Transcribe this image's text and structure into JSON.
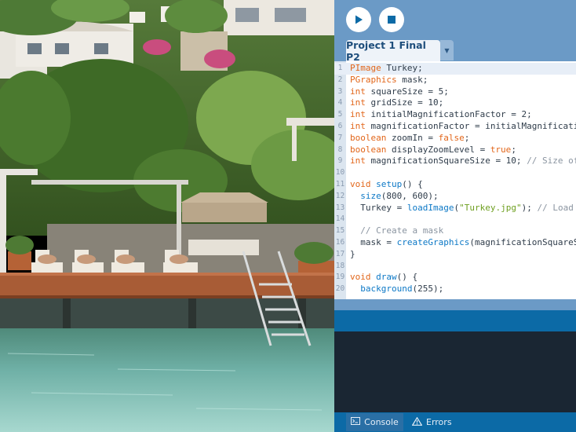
{
  "toolbar": {
    "run_icon": "play-icon",
    "stop_icon": "stop-icon"
  },
  "tabs": {
    "active": "Project 1 Final P2",
    "menu_icon": "chevron-down-icon"
  },
  "editor": {
    "lines": [
      {
        "n": "1",
        "parts": [
          {
            "t": "kw",
            "s": "PImage"
          },
          {
            "t": "",
            "s": " Turkey;"
          }
        ]
      },
      {
        "n": "2",
        "parts": [
          {
            "t": "kw",
            "s": "PGraphics"
          },
          {
            "t": "",
            "s": " mask;"
          }
        ]
      },
      {
        "n": "3",
        "parts": [
          {
            "t": "kw",
            "s": "int"
          },
          {
            "t": "",
            "s": " squareSize = 5;"
          }
        ]
      },
      {
        "n": "4",
        "parts": [
          {
            "t": "kw",
            "s": "int"
          },
          {
            "t": "",
            "s": " gridSize = 10;"
          }
        ]
      },
      {
        "n": "5",
        "parts": [
          {
            "t": "kw",
            "s": "int"
          },
          {
            "t": "",
            "s": " initialMagnificationFactor = 2;"
          }
        ]
      },
      {
        "n": "6",
        "parts": [
          {
            "t": "kw",
            "s": "int"
          },
          {
            "t": "",
            "s": " magnificationFactor = initialMagnification"
          }
        ]
      },
      {
        "n": "7",
        "parts": [
          {
            "t": "kw",
            "s": "boolean"
          },
          {
            "t": "",
            "s": " zoomIn = "
          },
          {
            "t": "kw",
            "s": "false"
          },
          {
            "t": "",
            "s": ";"
          }
        ]
      },
      {
        "n": "8",
        "parts": [
          {
            "t": "kw",
            "s": "boolean"
          },
          {
            "t": "",
            "s": " displayZoomLevel = "
          },
          {
            "t": "kw",
            "s": "true"
          },
          {
            "t": "",
            "s": ";"
          }
        ]
      },
      {
        "n": "9",
        "parts": [
          {
            "t": "kw",
            "s": "int"
          },
          {
            "t": "",
            "s": " magnificationSquareSize = 10; "
          },
          {
            "t": "cm",
            "s": "// Size of"
          }
        ]
      },
      {
        "n": "10",
        "parts": []
      },
      {
        "n": "11",
        "parts": [
          {
            "t": "kw",
            "s": "void"
          },
          {
            "t": "",
            "s": " "
          },
          {
            "t": "fn",
            "s": "setup"
          },
          {
            "t": "",
            "s": "() {"
          }
        ]
      },
      {
        "n": "12",
        "parts": [
          {
            "t": "",
            "s": "  "
          },
          {
            "t": "fn",
            "s": "size"
          },
          {
            "t": "",
            "s": "(800, 600);"
          }
        ]
      },
      {
        "n": "13",
        "parts": [
          {
            "t": "",
            "s": "  Turkey = "
          },
          {
            "t": "fn",
            "s": "loadImage"
          },
          {
            "t": "",
            "s": "("
          },
          {
            "t": "str",
            "s": "\"Turkey.jpg\""
          },
          {
            "t": "",
            "s": "); "
          },
          {
            "t": "cm",
            "s": "// Load t"
          }
        ]
      },
      {
        "n": "14",
        "parts": []
      },
      {
        "n": "15",
        "parts": [
          {
            "t": "",
            "s": "  "
          },
          {
            "t": "cm",
            "s": "// Create a mask"
          }
        ]
      },
      {
        "n": "16",
        "parts": [
          {
            "t": "",
            "s": "  mask = "
          },
          {
            "t": "fn",
            "s": "createGraphics"
          },
          {
            "t": "",
            "s": "(magnificationSquareSi"
          }
        ]
      },
      {
        "n": "17",
        "parts": [
          {
            "t": "",
            "s": "}"
          }
        ]
      },
      {
        "n": "18",
        "parts": []
      },
      {
        "n": "19",
        "parts": [
          {
            "t": "kw",
            "s": "void"
          },
          {
            "t": "",
            "s": " "
          },
          {
            "t": "fn",
            "s": "draw"
          },
          {
            "t": "",
            "s": "() {"
          }
        ]
      },
      {
        "n": "20",
        "parts": [
          {
            "t": "",
            "s": "  "
          },
          {
            "t": "fn",
            "s": "background"
          },
          {
            "t": "",
            "s": "(255);"
          }
        ]
      }
    ]
  },
  "footer": {
    "console_label": "Console",
    "errors_label": "Errors"
  },
  "colors": {
    "ide_background": "#6b9ac6",
    "keyword": "#e2661a",
    "function": "#0c78c6",
    "string": "#6e9f1f",
    "comment": "#8a94a0",
    "console_background": "#1a2633",
    "bar_blue": "#0c6aa6"
  }
}
